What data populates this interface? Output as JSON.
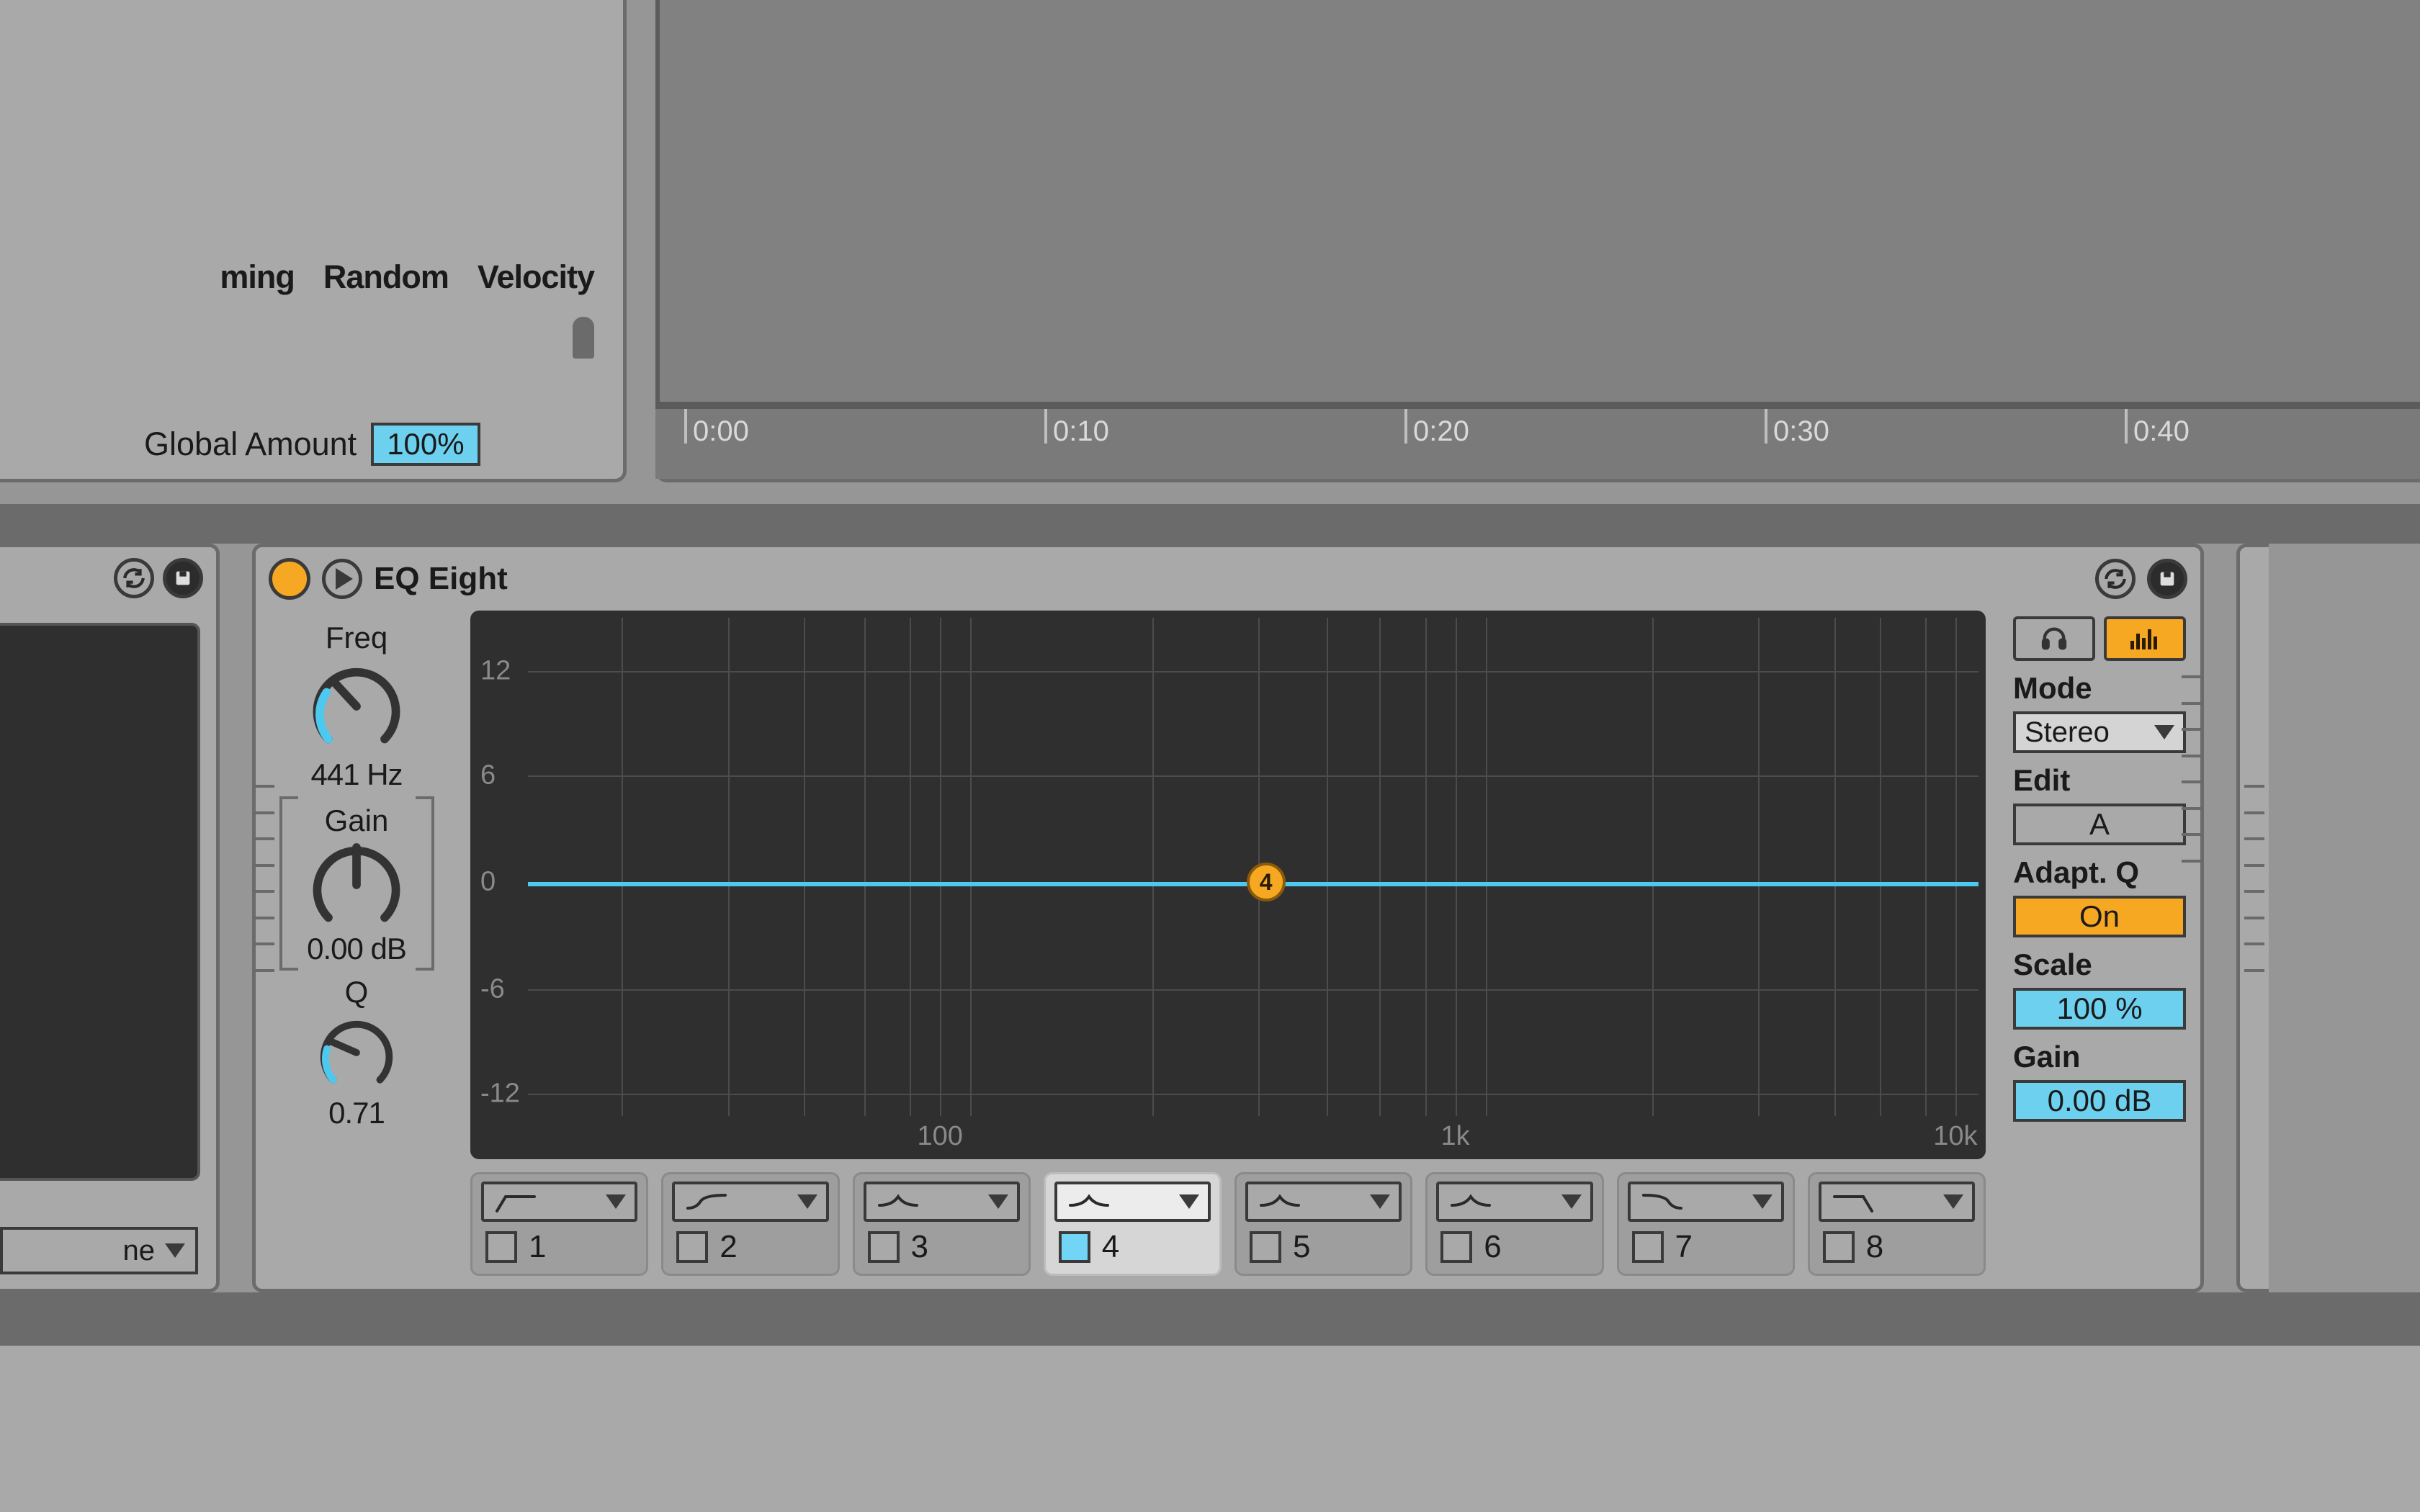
{
  "upper": {
    "effect_tabs": [
      "ming",
      "Random",
      "Velocity"
    ],
    "global_amount": {
      "label": "Global Amount",
      "value": "100%"
    },
    "ruler_ticks": [
      "0:00",
      "0:10",
      "0:20",
      "0:30",
      "0:40"
    ]
  },
  "left_sliver": {
    "dropdown_suffix": "ne"
  },
  "eq": {
    "title": "EQ Eight",
    "freq": {
      "label": "Freq",
      "value": "441 Hz"
    },
    "gain": {
      "label": "Gain",
      "value": "0.00 dB"
    },
    "q": {
      "label": "Q",
      "value": "0.71"
    },
    "graph": {
      "y_ticks": [
        "12",
        "6",
        "0",
        "-6",
        "-12"
      ],
      "x_ticks": [
        "100",
        "1k",
        "10k"
      ],
      "active_band_number": "4"
    },
    "bands": [
      {
        "num": "1",
        "active": false,
        "shape": "lowcut-slope"
      },
      {
        "num": "2",
        "active": false,
        "shape": "lowshelf"
      },
      {
        "num": "3",
        "active": false,
        "shape": "bell"
      },
      {
        "num": "4",
        "active": true,
        "shape": "bell"
      },
      {
        "num": "5",
        "active": false,
        "shape": "bell"
      },
      {
        "num": "6",
        "active": false,
        "shape": "bell"
      },
      {
        "num": "7",
        "active": false,
        "shape": "highshelf"
      },
      {
        "num": "8",
        "active": false,
        "shape": "highcut-slope"
      }
    ],
    "side": {
      "mode": {
        "label": "Mode",
        "value": "Stereo"
      },
      "edit": {
        "label": "Edit",
        "value": "A"
      },
      "adaptq": {
        "label": "Adapt. Q",
        "value": "On"
      },
      "scale": {
        "label": "Scale",
        "value": "100 %"
      },
      "outgain": {
        "label": "Gain",
        "value": "0.00 dB"
      }
    }
  }
}
